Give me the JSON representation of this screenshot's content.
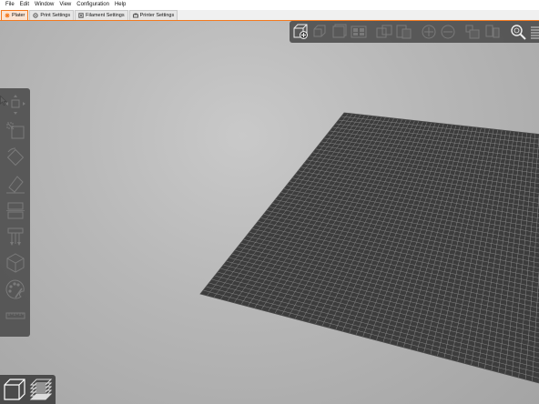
{
  "menubar": {
    "items": [
      "File",
      "Edit",
      "Window",
      "View",
      "Configuration",
      "Help"
    ]
  },
  "tabs": [
    {
      "label": "Plater",
      "icon": "plater-icon",
      "active": true
    },
    {
      "label": "Print Settings",
      "icon": "print-settings-icon",
      "active": false
    },
    {
      "label": "Filament Settings",
      "icon": "filament-settings-icon",
      "active": false
    },
    {
      "label": "Printer Settings",
      "icon": "printer-settings-icon",
      "active": false
    }
  ],
  "top_toolbar": {
    "buttons": [
      "add-icon",
      "delete-icon",
      "delete-all-icon",
      "arrange-icon",
      "copy-icon",
      "paste-icon",
      "add-instance-icon",
      "remove-instance-icon",
      "split-to-objects-icon",
      "split-to-parts-icon",
      "search-icon",
      "layers-editing-icon",
      "undo-icon"
    ]
  },
  "left_toolbar": {
    "buttons": [
      "move-icon",
      "scale-icon",
      "rotate-icon",
      "place-on-face-icon",
      "cut-icon",
      "support-points-icon",
      "hollow-icon",
      "paint-icon",
      "measure-icon"
    ]
  },
  "view_toggle": {
    "buttons": [
      "3d-view-icon",
      "preview-icon"
    ]
  },
  "colors": {
    "accent": "#f47a1f",
    "toolbar_bg": "#4b4b4b",
    "bed": "#3c3c3c",
    "bed_grid": "#8a8a8a",
    "viewport_bg": "#b7b7b7"
  }
}
